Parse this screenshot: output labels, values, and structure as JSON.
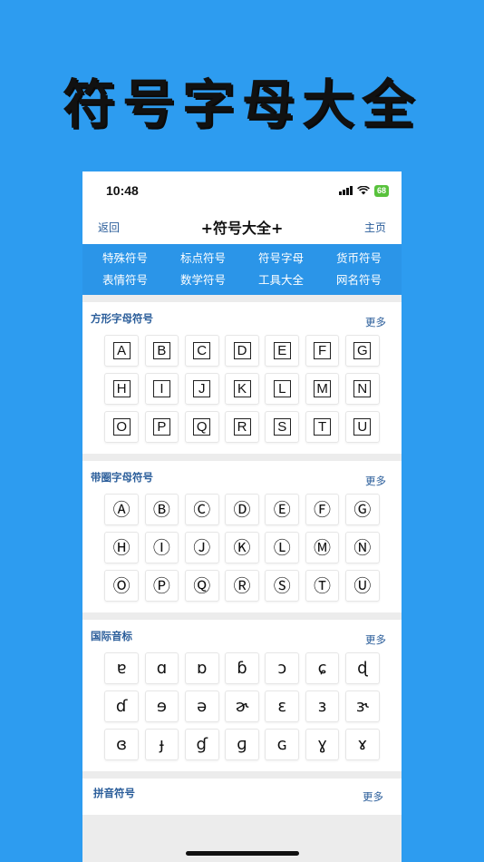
{
  "banner": {
    "title": "符号字母大全"
  },
  "status_bar": {
    "time": "10:48",
    "battery": "68"
  },
  "nav": {
    "back": "返回",
    "title": "+符号大全+",
    "home": "主页"
  },
  "tabs": [
    "特殊符号",
    "标点符号",
    "符号字母",
    "货币符号",
    "表情符号",
    "数学符号",
    "工具大全",
    "网名符号"
  ],
  "sections": [
    {
      "title": "方形字母符号",
      "more": "更多",
      "items": [
        "A",
        "B",
        "C",
        "D",
        "E",
        "F",
        "G",
        "H",
        "I",
        "J",
        "K",
        "L",
        "M",
        "N",
        "O",
        "P",
        "Q",
        "R",
        "S",
        "T",
        "U"
      ]
    },
    {
      "title": "带圈字母符号",
      "more": "更多",
      "items": [
        "Ⓐ",
        "Ⓑ",
        "Ⓒ",
        "Ⓓ",
        "Ⓔ",
        "Ⓕ",
        "Ⓖ",
        "Ⓗ",
        "Ⓘ",
        "Ⓙ",
        "Ⓚ",
        "Ⓛ",
        "Ⓜ",
        "Ⓝ",
        "Ⓞ",
        "Ⓟ",
        "Ⓠ",
        "Ⓡ",
        "Ⓢ",
        "Ⓣ",
        "Ⓤ"
      ]
    },
    {
      "title": "国际音标",
      "more": "更多",
      "items": [
        "ɐ",
        "ɑ",
        "ɒ",
        "ɓ",
        "ɔ",
        "ɕ",
        "ɖ",
        "ɗ",
        "ɘ",
        "ə",
        "ɚ",
        "ɛ",
        "ɜ",
        "ɝ",
        "ɞ",
        "ɟ",
        "ɠ",
        "ɡ",
        "ɢ",
        "ɣ",
        "ɤ"
      ]
    },
    {
      "title": "拼音符号",
      "more": "更多"
    }
  ]
}
